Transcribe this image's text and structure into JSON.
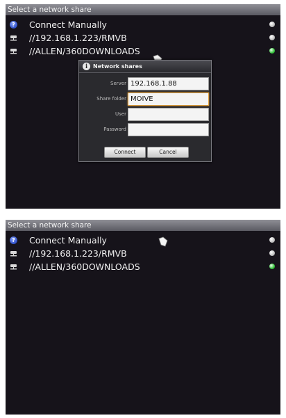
{
  "panels": [
    {
      "title": "Select a network share",
      "items": [
        {
          "label": "Connect Manually",
          "icon": "question-icon",
          "status_color": "#d0d0d0"
        },
        {
          "label": "//192.168.1.223/RMVB",
          "icon": "network-drive-icon",
          "status_color": "#d0d0d0"
        },
        {
          "label": "//ALLEN/360DOWNLOADS",
          "icon": "network-drive-icon",
          "status_color": "#34c23a"
        }
      ],
      "dialog": {
        "title": "Network shares",
        "fields": {
          "server": {
            "label": "Server",
            "value": "192.168.1.88"
          },
          "share_folder": {
            "label": "Share folder",
            "value": "MOIVE"
          },
          "user": {
            "label": "User",
            "value": ""
          },
          "password": {
            "label": "Password",
            "value": ""
          }
        },
        "connect_label": "Connect",
        "cancel_label": "Cancel"
      }
    },
    {
      "title": "Select a network share",
      "items": [
        {
          "label": "Connect Manually",
          "icon": "question-icon",
          "status_color": "#d0d0d0"
        },
        {
          "label": "//192.168.1.223/RMVB",
          "icon": "network-drive-icon",
          "status_color": "#d0d0d0"
        },
        {
          "label": "//ALLEN/360DOWNLOADS",
          "icon": "network-drive-icon",
          "status_color": "#34c23a"
        }
      ]
    }
  ],
  "colors": {
    "screen_background": "#16131a",
    "titlebar": "#7a7a80",
    "connected": "#34c23a",
    "focus_border": "#e0a040"
  }
}
